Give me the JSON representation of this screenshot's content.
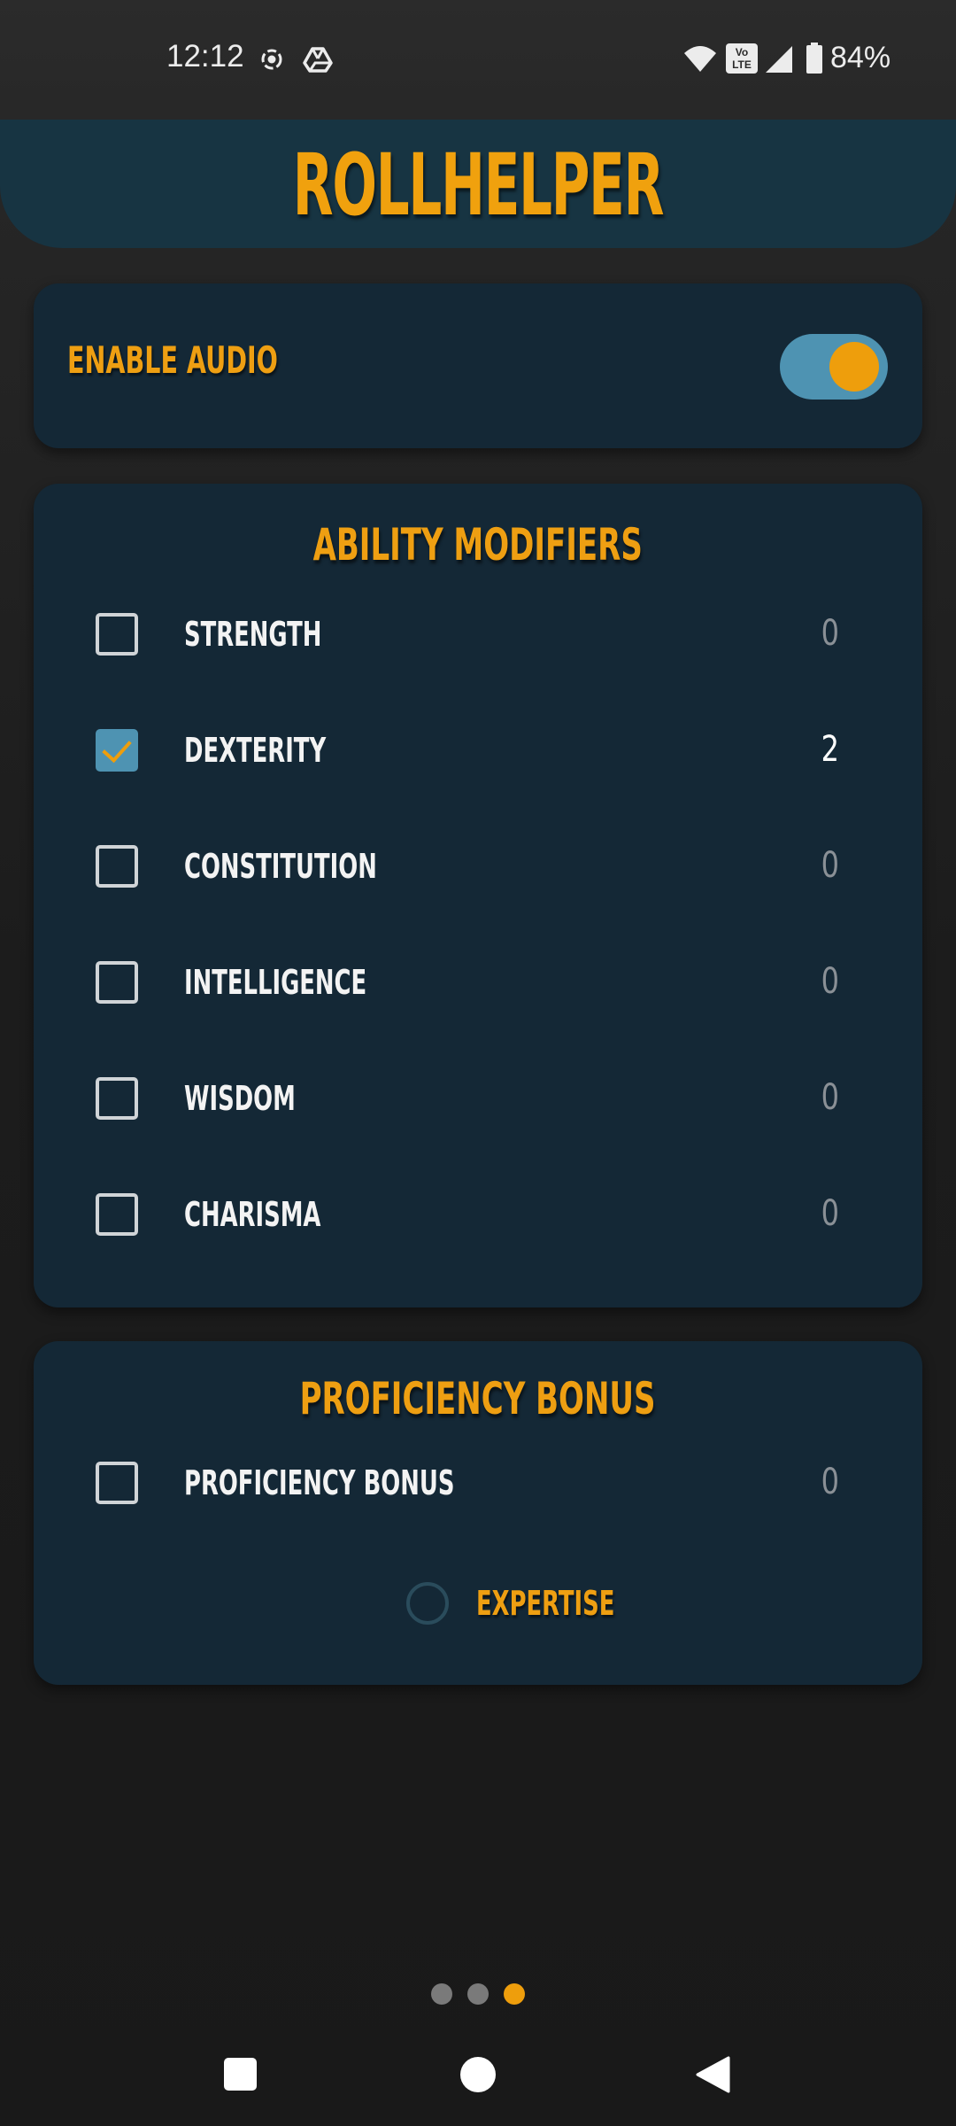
{
  "status_bar": {
    "time": "12:12",
    "battery_percent": "84%",
    "icons": [
      "screen-record-icon",
      "drive-icon",
      "wifi-icon",
      "volte-icon",
      "signal-icon",
      "battery-icon"
    ],
    "volte_text": "Vo LTE"
  },
  "header": {
    "title": "ROLLHELPER"
  },
  "audio": {
    "label": "ENABLE AUDIO",
    "enabled": true
  },
  "abilities": {
    "title": "ABILITY MODIFIERS",
    "items": [
      {
        "label": "STRENGTH",
        "value": "0",
        "checked": false
      },
      {
        "label": "DEXTERITY",
        "value": "2",
        "checked": true
      },
      {
        "label": "CONSTITUTION",
        "value": "0",
        "checked": false
      },
      {
        "label": "INTELLIGENCE",
        "value": "0",
        "checked": false
      },
      {
        "label": "WISDOM",
        "value": "0",
        "checked": false
      },
      {
        "label": "CHARISMA",
        "value": "0",
        "checked": false
      }
    ]
  },
  "proficiency": {
    "title": "PROFICIENCY BONUS",
    "item": {
      "label": "PROFICIENCY BONUS",
      "value": "0",
      "checked": false
    },
    "expertise": {
      "label": "EXPERTISE",
      "selected": false
    }
  },
  "pager": {
    "count": 3,
    "active_index": 2
  },
  "colors": {
    "accent": "#ee9f12",
    "card": "#142836",
    "header": "#173442",
    "toggle_track": "#4e93b2",
    "dot_inactive": "#7a7a7a"
  },
  "nav": {
    "icons": [
      "recents-square-icon",
      "home-circle-icon",
      "back-triangle-icon"
    ]
  }
}
